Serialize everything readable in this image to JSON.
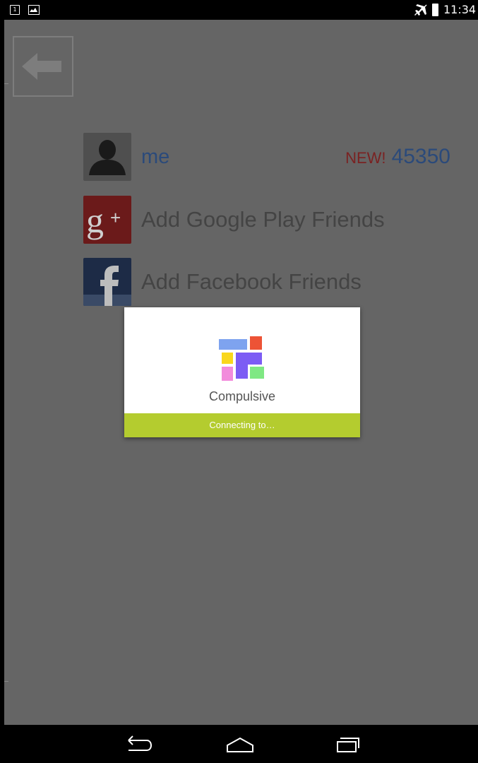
{
  "status_bar": {
    "time": "11:34",
    "calendar_day": "1",
    "icons": [
      "calendar-icon",
      "gallery-icon",
      "airplane-mode-icon",
      "battery-icon"
    ]
  },
  "app": {
    "back_icon": "arrow-left-icon",
    "rows": [
      {
        "icon": "avatar-icon",
        "label": "me",
        "badge": "NEW!",
        "score": "45350"
      },
      {
        "icon": "google-plus-icon",
        "label": "Add Google Play Friends"
      },
      {
        "icon": "facebook-icon",
        "label": "Add Facebook Friends"
      }
    ]
  },
  "dialog": {
    "app_name": "Compulsive",
    "status": "Connecting to…"
  },
  "nav_bar": {
    "buttons": [
      "back-icon",
      "home-icon",
      "recent-apps-icon"
    ]
  },
  "colors": {
    "overlay": "#656565",
    "accent": "#b4cc2f",
    "new_badge": "#7a2222",
    "link_blue": "#2b4a7a",
    "logo_blue": "#7ea3ef",
    "logo_red": "#ed5336",
    "logo_yellow": "#f9d71c",
    "logo_purple": "#7c5cf4",
    "logo_pink": "#f28bdc",
    "logo_green": "#7fe883"
  }
}
